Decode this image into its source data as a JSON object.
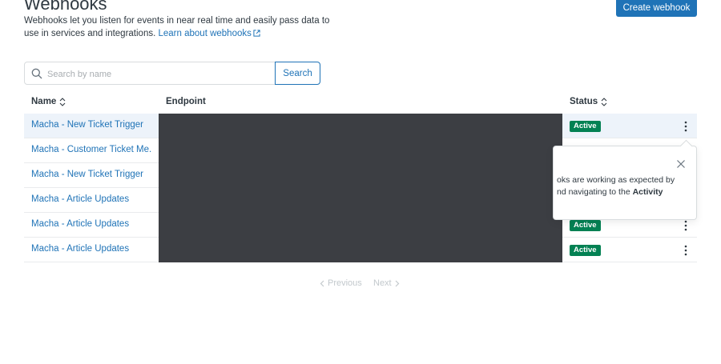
{
  "header": {
    "title": "Webhooks",
    "description": "Webhooks let you listen for events in near real time and easily pass data to use in services and integrations.",
    "learn_link": "Learn about webhooks",
    "create_button": "Create webhook"
  },
  "search": {
    "placeholder": "Search by name",
    "value": "",
    "button": "Search"
  },
  "table": {
    "columns": [
      "Name",
      "Endpoint",
      "Status"
    ],
    "rows": [
      {
        "name": "Macha - New Ticket Trigger",
        "status": "Active"
      },
      {
        "name": "Macha - Customer Ticket Me...",
        "status": ""
      },
      {
        "name": "Macha - New Ticket Trigger",
        "status": ""
      },
      {
        "name": "Macha - Article Updates",
        "status": ""
      },
      {
        "name": "Macha - Article Updates",
        "status": "Active"
      },
      {
        "name": "Macha - Article Updates",
        "status": "Active"
      }
    ]
  },
  "popover": {
    "line1": "oks are working as expected by",
    "line2_prefix": "nd navigating to the ",
    "line2_bold": "Activity"
  },
  "pagination": {
    "previous": "Previous",
    "next": "Next"
  },
  "colors": {
    "primary": "#1f73b7",
    "active_badge": "#038153",
    "row_highlight": "#edf3fa",
    "redaction": "#3c3e43"
  },
  "icons": [
    "search-icon",
    "sort-icon",
    "external-link-icon",
    "close-icon",
    "kebab-menu-icon",
    "chevron-left-icon",
    "chevron-right-icon"
  ]
}
